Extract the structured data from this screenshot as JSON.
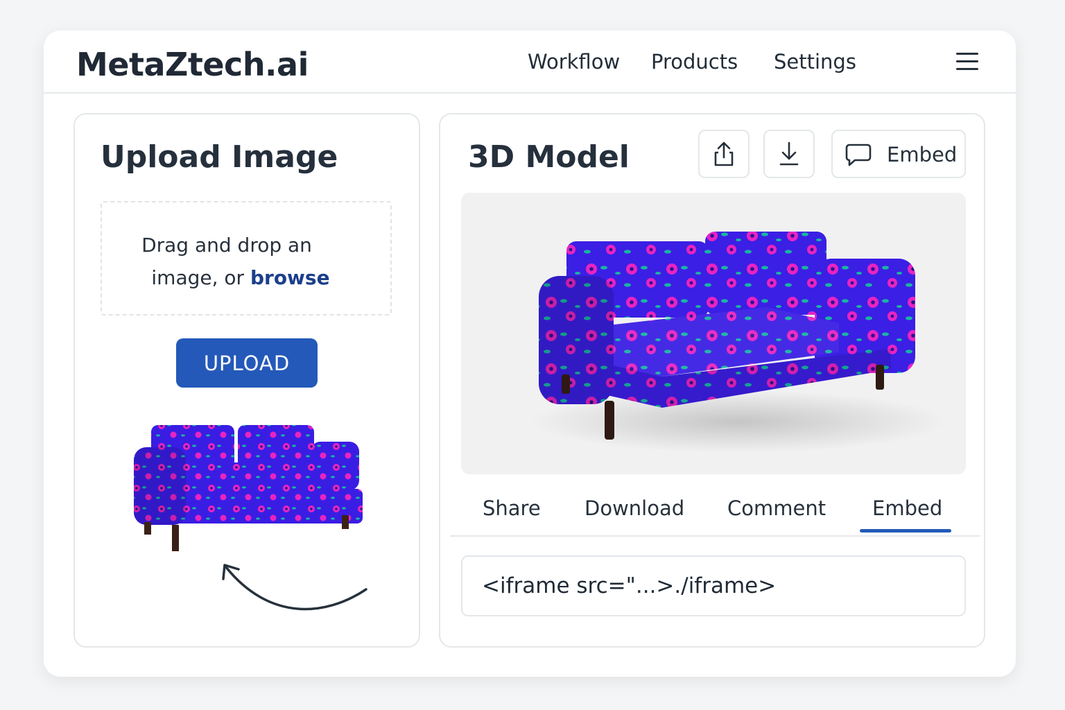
{
  "header": {
    "logo": "MetaZtech.ai",
    "nav": [
      "Workflow",
      "Products",
      "Settings"
    ],
    "menu_icon": "hamburger-menu-icon"
  },
  "upload_panel": {
    "title": "Upload Image",
    "dropzone_line1": "Drag and drop an",
    "dropzone_line2_prefix": "image, or ",
    "dropzone_link": "browse",
    "upload_button": "UPLOAD",
    "preview_image": "floral-sofa-thumbnail",
    "arrow_icon": "curved-arrow-icon"
  },
  "model_panel": {
    "title": "3D Model",
    "actions": {
      "share_icon": "share-icon",
      "download_icon": "download-icon",
      "embed_icon": "comment-icon",
      "embed_label": "Embed"
    },
    "viewer_image": "floral-sofa-3d-model",
    "tabs": [
      "Share",
      "Download",
      "Comment",
      "Embed"
    ],
    "active_tab": "Embed",
    "embed_code": "<iframe src=\"...>./iframe>"
  },
  "colors": {
    "accent": "#2459b9",
    "link": "#1b3f8b",
    "sofa_fabric": "#3d1fe6",
    "flower": "#ea23c4",
    "leaf": "#14b6a6"
  }
}
